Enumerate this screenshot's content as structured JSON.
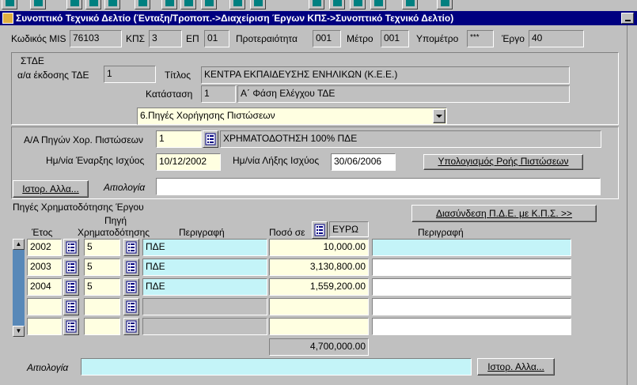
{
  "window": {
    "title": "Συνοπτικό Τεχνικό Δελτίο (Ένταξη/Τροποπ.->Διαχείριση Έργων ΚΠΣ->Συνοπτικό Τεχνικό Δελτίο)"
  },
  "header": {
    "mis_label": "Κωδικός MIS",
    "mis_value": "76103",
    "kps_label": "ΚΠΣ",
    "kps_value": "3",
    "ep_label": "ΕΠ",
    "ep_value": "01",
    "priority_label": "Προτεραιότητα",
    "priority_value": "001",
    "metro_label": "Μέτρο",
    "metro_value": "001",
    "submetro_label": "Υπομέτρο",
    "submetro_value": "***",
    "ergo_label": "Έργο",
    "ergo_value": "40"
  },
  "std": {
    "section_label": "ΣΤΔΕ",
    "issue_label": "α/α έκδοσης ΤΔΕ",
    "issue_value": "1",
    "title_label": "Τίτλος",
    "title_value": "ΚΕΝΤΡΑ ΕΚΠΑΙΔΕΥΣΗΣ ΕΝΗΛΙΚΩΝ (Κ.Ε.Ε.)",
    "status_label": "Κατάσταση",
    "status_code": "1",
    "status_text": "Α΄ Φάση Ελέγχου ΤΔΕ",
    "tab_select": "6.Πηγές Χορήγησης Πιστώσεων"
  },
  "funding": {
    "aa_label": "Α/Α Πηγών Χορ. Πιστώσεων",
    "aa_value": "1",
    "aa_desc": "ΧΡΗΜΑΤΟΔΟΤΗΣΗ  100% ΠΔΕ",
    "start_label": "Ημ/νία Έναρξης Ισχύος",
    "start_value": "10/12/2002",
    "end_label": "Ημ/νία Λήξης Ισχύος",
    "end_value": "30/06/2006",
    "calc_button": "Υπολογισμός Ροής Πιστώσεων",
    "history_button": "Ιστορ. Αλλα...",
    "reason_label": "Αιτιολογία",
    "reason_value": ""
  },
  "sources": {
    "section_label": "Πηγές Χρηματοδότησης Έργου",
    "link_button": "Διασύνδεση Π.Δ.Ε. με Κ.Π.Σ. >>",
    "col_year": "Έτος",
    "col_source_top": "Πηγή",
    "col_source": "Χρηματοδότησης",
    "col_desc": "Περιγραφή",
    "col_amount": "Ποσό σε",
    "currency": "ΕΥΡΩ",
    "col_desc2": "Περιγραφή",
    "rows": [
      {
        "year": "2002",
        "source": "5",
        "desc": "ΠΔΕ",
        "amount": "10,000.00",
        "desc2": ""
      },
      {
        "year": "2003",
        "source": "5",
        "desc": "ΠΔΕ",
        "amount": "3,130,800.00",
        "desc2": ""
      },
      {
        "year": "2004",
        "source": "5",
        "desc": "ΠΔΕ",
        "amount": "1,559,200.00",
        "desc2": ""
      },
      {
        "year": "",
        "source": "",
        "desc": "",
        "amount": "",
        "desc2": ""
      },
      {
        "year": "",
        "source": "",
        "desc": "",
        "amount": "",
        "desc2": ""
      }
    ],
    "total": "4,700,000.00",
    "reason_label": "Αιτιολογία",
    "reason_value": "",
    "history_button": "Ιστορ. Αλλα..."
  }
}
